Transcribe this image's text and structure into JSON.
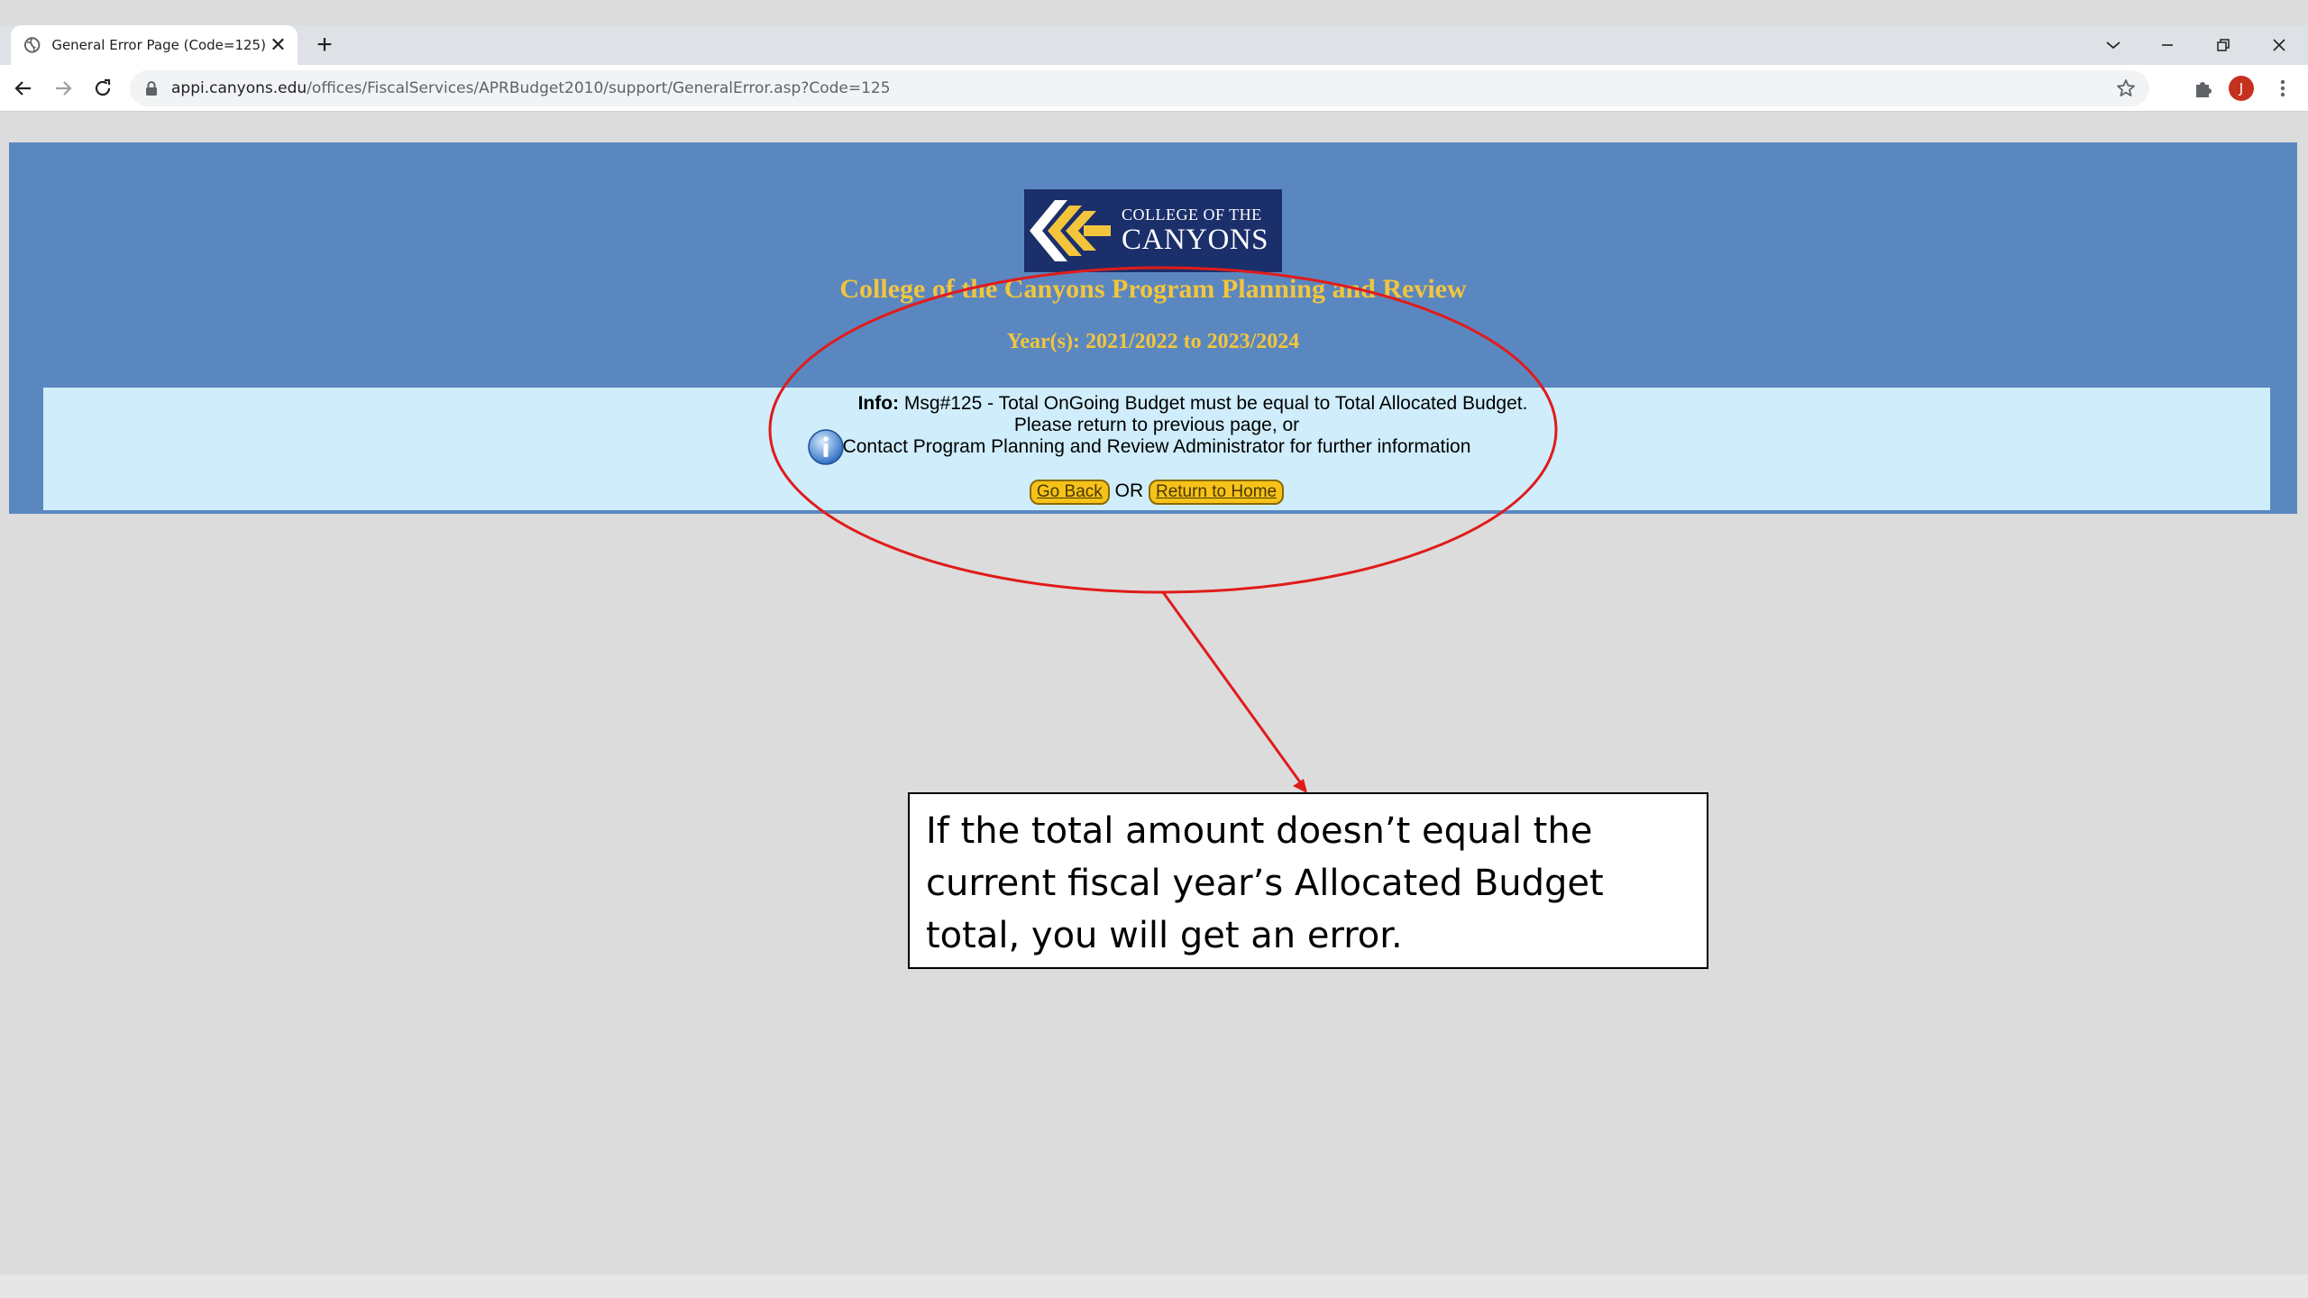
{
  "browser": {
    "tab_title": "General Error Page (Code=125)",
    "url_host": "appi.canyons.edu",
    "url_path": "/offices/FiscalServices/APRBudget2010/support/GeneralError.asp?Code=125",
    "avatar_letter": "J",
    "icons": [
      "globe-icon",
      "close-icon",
      "plus-icon",
      "chevron-down-icon",
      "minimize-icon",
      "restore-icon",
      "window-close-icon",
      "back-arrow-icon",
      "forward-arrow-icon",
      "reload-icon",
      "lock-icon",
      "star-icon",
      "puzzle-icon",
      "kebab-menu-icon"
    ]
  },
  "page": {
    "logo_line1": "COLLEGE OF THE",
    "logo_line2": "CANYONS",
    "title": "College of the Canyons Program Planning and Review",
    "years": "Year(s): 2021/2022 to 2023/2024",
    "info_label": "Info:",
    "info_message": "Msg#125 - Total OnGoing Budget must be equal to Total Allocated Budget.",
    "info_line2": "Please return to previous page, or",
    "info_line3": "Contact Program Planning and Review Administrator for further information",
    "go_back": "Go Back",
    "or_text": "OR",
    "return_home": "Return to Home"
  },
  "annotation": {
    "callout_text": "If the total amount doesn’t equal the current fiscal year’s Allocated Budget total, you will get an error.",
    "ellipse_color": "#e11b1b",
    "arrow_color": "#e11b1b"
  },
  "colors": {
    "banner": "#5b87c0",
    "title_gold": "#f2c53d",
    "info_panel": "#cfedfb",
    "button_yellow": "#f6c21a"
  }
}
